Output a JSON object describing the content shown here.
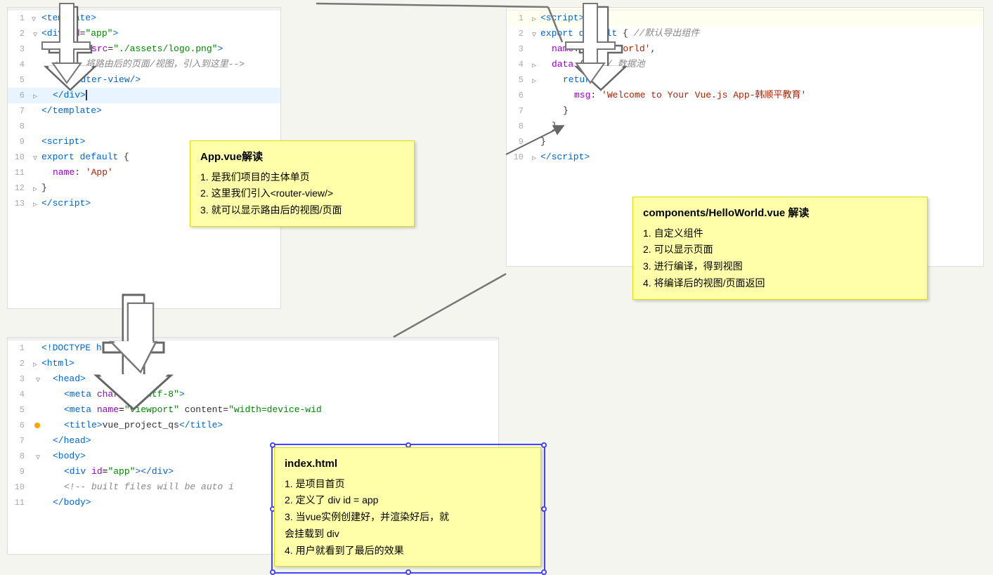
{
  "app_template_panel": {
    "lines": [
      {
        "num": "1",
        "indent": 0,
        "content": "&lt;template&gt;",
        "type": "tag"
      },
      {
        "num": "2",
        "indent": 1,
        "content": "&lt;div id=\"app\"&gt;",
        "type": "tag"
      },
      {
        "num": "3",
        "indent": 2,
        "content": "&lt;img src=\"./assets/logo.png\"&gt;",
        "type": "tag"
      },
      {
        "num": "4",
        "indent": 1,
        "content": "&lt;!--  将路由后的页面/视图，引入到这里--&gt;",
        "type": "comment"
      },
      {
        "num": "5",
        "indent": 2,
        "content": "&lt;router-view/&gt;",
        "type": "tag"
      },
      {
        "num": "6",
        "indent": 1,
        "content": "&lt;/div&gt;",
        "type": "tag",
        "highlight": true,
        "cursor": true
      },
      {
        "num": "7",
        "indent": 0,
        "content": "&lt;/template&gt;",
        "type": "tag"
      },
      {
        "num": "8",
        "indent": 0,
        "content": "",
        "type": "plain"
      },
      {
        "num": "9",
        "indent": 0,
        "content": "&lt;script&gt;",
        "type": "tag"
      },
      {
        "num": "10",
        "indent": 0,
        "content": "export default {",
        "type": "plain"
      },
      {
        "num": "11",
        "indent": 1,
        "content": "name: 'App'",
        "type": "plain"
      },
      {
        "num": "12",
        "indent": 0,
        "content": "}",
        "type": "plain"
      },
      {
        "num": "13",
        "indent": 0,
        "content": "&lt;/script&gt;",
        "type": "tag"
      }
    ]
  },
  "hello_script_panel": {
    "lines": [
      {
        "num": "1",
        "indent": 0,
        "content": "&lt;script&gt;",
        "type": "tag"
      },
      {
        "num": "2",
        "indent": 0,
        "content": "export default { //默认导出组件",
        "type": "plain_comment"
      },
      {
        "num": "3",
        "indent": 1,
        "content": "name: 'HelloWorld',",
        "type": "plain"
      },
      {
        "num": "4",
        "indent": 1,
        "content": "data () {// 数据池",
        "type": "plain_comment"
      },
      {
        "num": "5",
        "indent": 2,
        "content": "return {",
        "type": "plain"
      },
      {
        "num": "6",
        "indent": 3,
        "content": "msg: 'Welcome to Your Vue.js App-韩顺平教育'",
        "type": "string_line"
      },
      {
        "num": "7",
        "indent": 2,
        "content": "}",
        "type": "plain"
      },
      {
        "num": "8",
        "indent": 1,
        "content": "}",
        "type": "plain"
      },
      {
        "num": "9",
        "indent": 0,
        "content": "}",
        "type": "plain"
      },
      {
        "num": "10",
        "indent": 0,
        "content": "&lt;/script&gt;",
        "type": "tag"
      }
    ]
  },
  "index_html_panel": {
    "lines": [
      {
        "num": "1",
        "indent": 0,
        "content": "&lt;!DOCTYPE html&gt;",
        "type": "tag"
      },
      {
        "num": "2",
        "indent": 0,
        "content": "&lt;html&gt;",
        "type": "tag"
      },
      {
        "num": "3",
        "indent": 1,
        "content": "&lt;head&gt;",
        "type": "tag"
      },
      {
        "num": "4",
        "indent": 2,
        "content": "&lt;meta charset=\"utf-8\"&gt;",
        "type": "tag"
      },
      {
        "num": "5",
        "indent": 2,
        "content": "&lt;meta name=\"viewport\" content=\"width=device-wid",
        "type": "tag"
      },
      {
        "num": "6",
        "indent": 2,
        "content": "&lt;title&gt;vue_project_qs&lt;/title&gt;",
        "type": "tag",
        "orange_dot": true
      },
      {
        "num": "7",
        "indent": 1,
        "content": "&lt;/head&gt;",
        "type": "tag"
      },
      {
        "num": "8",
        "indent": 1,
        "content": "&lt;body&gt;",
        "type": "tag"
      },
      {
        "num": "9",
        "indent": 2,
        "content": "&lt;div id=\"app\"&gt;&lt;/div&gt;",
        "type": "tag"
      },
      {
        "num": "10",
        "indent": 2,
        "content": "&lt;!-- built files will be auto i",
        "type": "comment"
      },
      {
        "num": "11",
        "indent": 1,
        "content": "&lt;/body&gt;",
        "type": "tag"
      }
    ]
  },
  "annotations": {
    "app_vue": {
      "title": "App.vue解读",
      "items": [
        "1. 是我们项目的主体单页",
        "2. 这里我们引入＜router-view/＞",
        "3. 就可以显示路由后的视图/页面"
      ]
    },
    "hello_world": {
      "title": "components/HelloWorld.vue 解读",
      "items": [
        "1. 自定义组件",
        "2. 可以显示页面",
        "3. 进行编译，得到视图",
        "4. 将编译后的视图/页面返回"
      ]
    },
    "index_html": {
      "title": "index.html",
      "items": [
        "1. 是项目首页",
        "2. 定义了 div id = app",
        "3. 当vue实例创建好，并渲染好后，就\n   会挂载到 div",
        "4. 用户就看到了最后的效果"
      ]
    }
  }
}
